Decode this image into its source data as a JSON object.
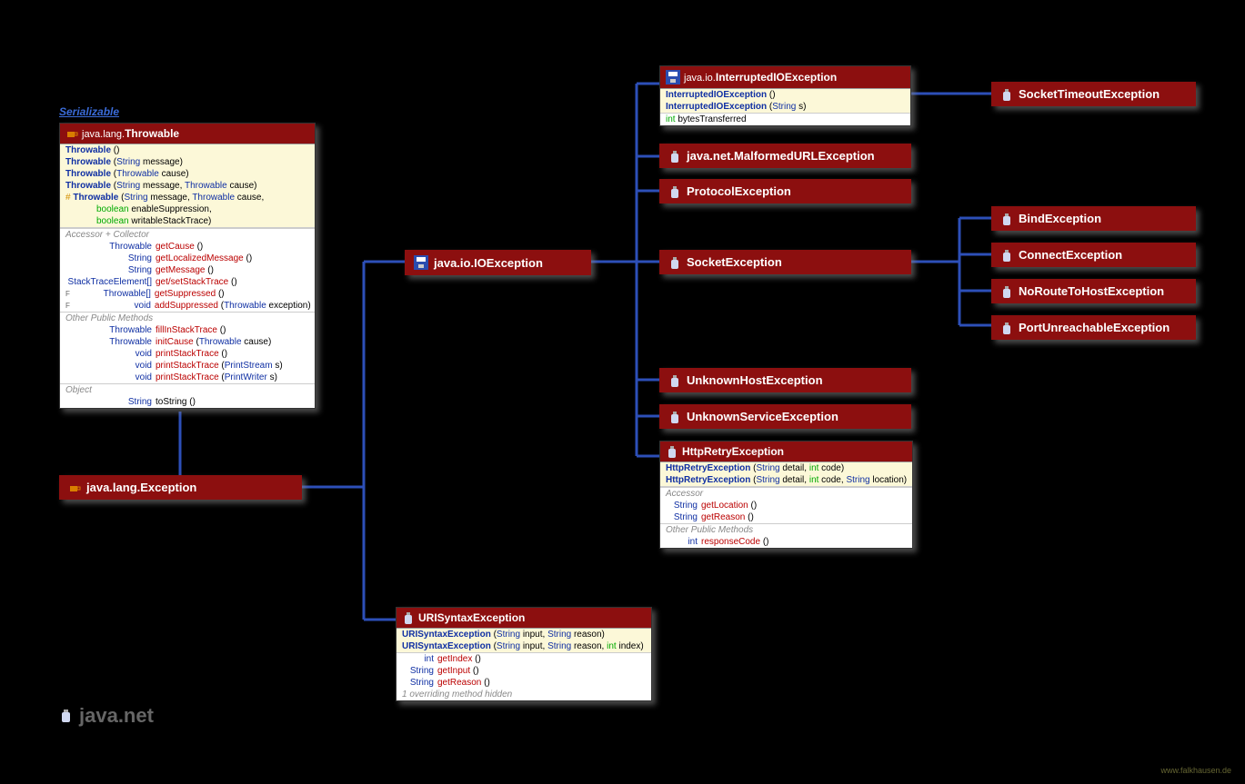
{
  "serializable": "Serializable",
  "throwable": {
    "pkg": "java.lang.",
    "name": "Throwable",
    "ctors": [
      {
        "sig": "Throwable",
        "args": "()"
      },
      {
        "sig": "Throwable",
        "args": "(String message)",
        "parts": [
          [
            "t",
            "String"
          ],
          [
            "p",
            " message)"
          ]
        ]
      },
      {
        "sig": "Throwable",
        "args": "(Throwable cause)",
        "parts": [
          [
            "t",
            "Throwable"
          ],
          [
            "p",
            " cause)"
          ]
        ]
      },
      {
        "sig": "Throwable",
        "args": "(String message, Throwable cause)"
      },
      {
        "mod": "#",
        "sig": "Throwable",
        "args": "(String message, Throwable cause,"
      },
      {
        "cont": "boolean enableSuppression,"
      },
      {
        "cont": "boolean writableStackTrace)"
      }
    ],
    "sects": [
      {
        "label": "Accessor + Collector",
        "rows": [
          {
            "ret": "Throwable",
            "m": "getCause",
            "a": "()"
          },
          {
            "ret": "String",
            "m": "getLocalizedMessage",
            "a": "()"
          },
          {
            "ret": "String",
            "m": "getMessage",
            "a": "()"
          },
          {
            "ret": "StackTraceElement[]",
            "m": "get/setStackTrace",
            "a": "()"
          },
          {
            "pre": "F",
            "ret": "Throwable[]",
            "m": "getSuppressed",
            "a": "()"
          },
          {
            "pre": "F",
            "ret": "void",
            "m": "addSuppressed",
            "a": "(Throwable exception)"
          }
        ]
      },
      {
        "label": "Other Public Methods",
        "rows": [
          {
            "ret": "Throwable",
            "m": "fillInStackTrace",
            "a": "()"
          },
          {
            "ret": "Throwable",
            "m": "initCause",
            "a": "(Throwable cause)"
          },
          {
            "ret": "void",
            "m": "printStackTrace",
            "a": "()"
          },
          {
            "ret": "void",
            "m": "printStackTrace",
            "a": "(PrintStream s)"
          },
          {
            "ret": "void",
            "m": "printStackTrace",
            "a": "(PrintWriter s)"
          }
        ]
      },
      {
        "label": "Object",
        "rows": [
          {
            "ret": "String",
            "m": "toString",
            "a": "()",
            "plain": true
          }
        ]
      }
    ]
  },
  "exception": {
    "pkg": "java.lang.",
    "name": "Exception"
  },
  "ioexception": {
    "pkg": "java.io.",
    "name": "IOException"
  },
  "uri": {
    "name": "URISyntaxException",
    "ctors": [
      {
        "sig": "URISyntaxException",
        "args": "(String input, String reason)"
      },
      {
        "sig": "URISyntaxException",
        "args": "(String input, String reason, int index)"
      }
    ],
    "rows": [
      {
        "ret": "int",
        "m": "getIndex",
        "a": "()"
      },
      {
        "ret": "String",
        "m": "getInput",
        "a": "()"
      },
      {
        "ret": "String",
        "m": "getReason",
        "a": "()"
      }
    ],
    "note": "1 overriding method hidden"
  },
  "interrupted": {
    "pkg": "java.io.",
    "name": "InterruptedIOException",
    "ctors": [
      {
        "sig": "InterruptedIOException",
        "args": "()"
      },
      {
        "sig": "InterruptedIOException",
        "args": "(String s)"
      }
    ],
    "field": {
      "ret": "int",
      "name": "bytesTransferred"
    }
  },
  "malformed": {
    "pkg": "java.net.",
    "name": "MalformedURLException"
  },
  "protocol": "ProtocolException",
  "socketTimeout": "SocketTimeoutException",
  "socket": "SocketException",
  "bind": "BindException",
  "connect": "ConnectException",
  "noroute": "NoRouteToHostException",
  "portun": "PortUnreachableException",
  "unknownHost": "UnknownHostException",
  "unknownService": "UnknownServiceException",
  "httpRetry": {
    "name": "HttpRetryException",
    "ctors": [
      {
        "sig": "HttpRetryException",
        "args": "(String detail, int code)"
      },
      {
        "sig": "HttpRetryException",
        "args": "(String detail, int code, String location)"
      }
    ],
    "acc": [
      {
        "ret": "String",
        "m": "getLocation",
        "a": "()"
      },
      {
        "ret": "String",
        "m": "getReason",
        "a": "()"
      }
    ],
    "other": [
      {
        "ret": "int",
        "m": "responseCode",
        "a": "()"
      }
    ]
  },
  "title": "java.net",
  "credit": "www.falkhausen.de"
}
